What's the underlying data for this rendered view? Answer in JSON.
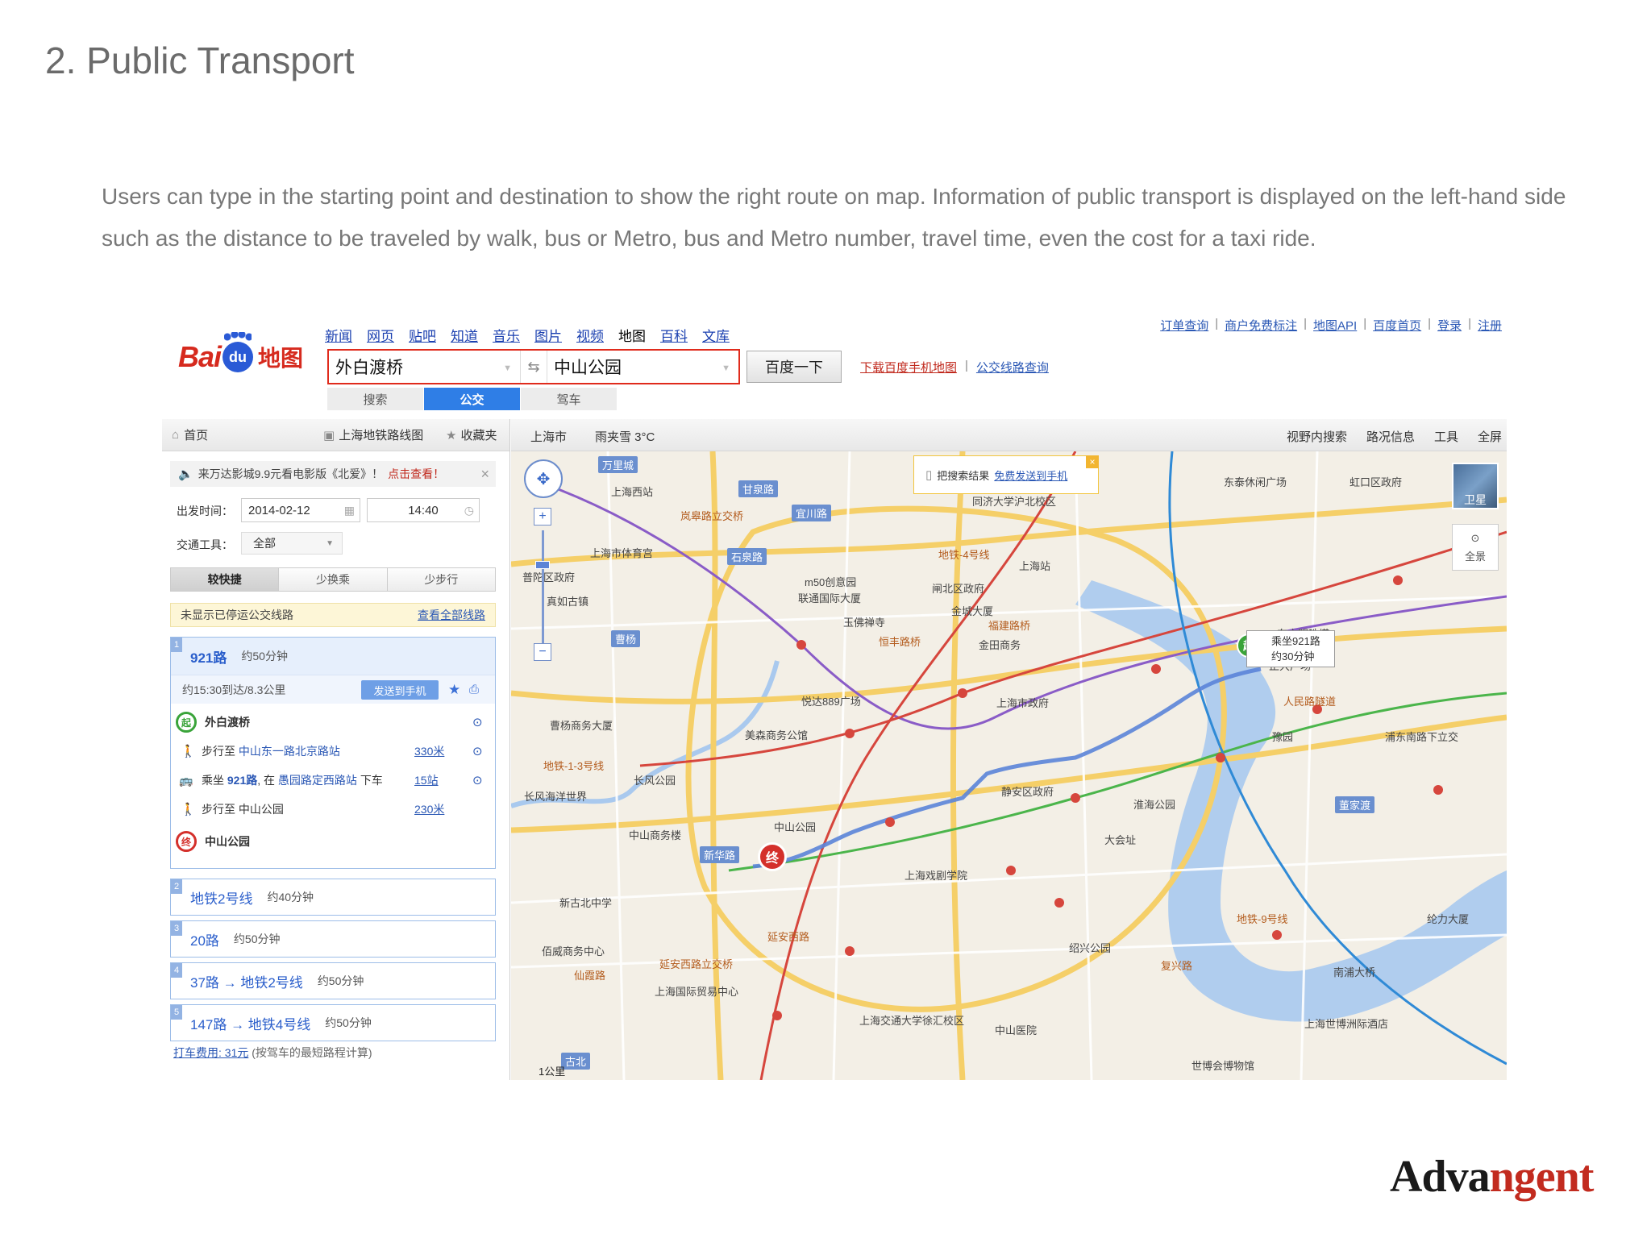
{
  "page": {
    "section_title": "2. Public Transport",
    "description": "Users can type in the starting point and destination to show the right route on map. Information of public transport is displayed on the left-hand side such as the distance to be traveled by walk, bus or Metro, bus and Metro number, travel time, even the cost for a taxi ride.",
    "brand_prefix": "Adva",
    "brand_suffix": "ngent",
    "brand_color": "#c22b1f"
  },
  "header": {
    "logo_bai": "Bai",
    "logo_du": "du",
    "logo_map": "地图",
    "nav": [
      "新闻",
      "网页",
      "贴吧",
      "知道",
      "音乐",
      "图片",
      "视频",
      "地图",
      "百科",
      "文库"
    ],
    "nav_current": "地图",
    "top_links": [
      "订单查询",
      "商户免费标注",
      "地图API",
      "百度首页",
      "登录",
      "注册"
    ],
    "from_value": "外白渡桥",
    "to_value": "中山公园",
    "search_button": "百度一下",
    "download_link": "下载百度手机地图",
    "bus_query_link": "公交线路查询",
    "mode_tabs": [
      "搜索",
      "公交",
      "驾车"
    ],
    "mode_active": "公交"
  },
  "left_panel": {
    "home": "首页",
    "subway_map": "上海地铁路线图",
    "favorites": "收藏夹",
    "notice_text": "来万达影城9.9元看电影版《北爱》！",
    "notice_link": "点击查看！",
    "depart_label": "出发时间：",
    "date_value": "2014-02-12",
    "time_value": "14:40",
    "transport_label": "交通工具：",
    "transport_value": "全部",
    "prefs": [
      "较快捷",
      "少换乘",
      "少步行"
    ],
    "pref_active": "较快捷",
    "hidden_notice": "未显示已停运公交线路",
    "show_all_link": "查看全部线路",
    "route1": {
      "index": "1",
      "name": "921路",
      "time": "约50分钟",
      "summary": "约15:30到达/8.3公里",
      "send_button": "发送到手机",
      "steps": [
        {
          "type": "start",
          "icon": "起",
          "text": "外白渡桥"
        },
        {
          "type": "walk",
          "prefix": "步行至",
          "place": "中山东一路北京路站",
          "dist": "330米"
        },
        {
          "type": "bus",
          "prefix": "乘坐",
          "line": "921路",
          "mid": ", 在",
          "stop": "愚园路定西路站",
          "suffix": "下车",
          "dist": "15站"
        },
        {
          "type": "walk",
          "prefix": "步行至",
          "place": "中山公园",
          "dist": "230米"
        },
        {
          "type": "end",
          "icon": "终",
          "text": "中山公园"
        }
      ]
    },
    "other_routes": [
      {
        "index": "2",
        "name": "地铁2号线",
        "time": "约40分钟"
      },
      {
        "index": "3",
        "name": "20路",
        "time": "约50分钟"
      },
      {
        "index": "4",
        "name": "37路 → 地铁2号线",
        "time": "约50分钟"
      },
      {
        "index": "5",
        "name": "147路 → 地铁4号线",
        "time": "约50分钟"
      }
    ],
    "taxi_link": "打车费用: 31元",
    "taxi_note": "(按驾车的最短路程计算)"
  },
  "map": {
    "city": "上海市",
    "weather": "雨夹雪 3°C",
    "tools": [
      "视野内搜索",
      "路况信息",
      "工具",
      "全屏"
    ],
    "callout_text": "把搜索结果",
    "callout_link": "免费发送到手机",
    "satellite": "卫星",
    "panorama": "全景",
    "scale": "1公里",
    "bus_bubble_line1": "乘坐921路",
    "bus_bubble_line2": "约30分钟",
    "start_icon": "起",
    "end_icon": "终",
    "labels": [
      {
        "t": "万里城",
        "s": "blue"
      },
      {
        "t": "甘泉路",
        "s": "blue"
      },
      {
        "t": "宜川路",
        "s": "blue"
      },
      {
        "t": "石泉路",
        "s": "blue"
      },
      {
        "t": "曹杨",
        "s": "blue"
      },
      {
        "t": "新华路",
        "s": "blue"
      },
      {
        "t": "董家渡",
        "s": "blue"
      },
      {
        "t": "古北",
        "s": "blue"
      },
      {
        "t": "上海西站",
        "s": ""
      },
      {
        "t": "岚皋路立交桥",
        "s": "road"
      },
      {
        "t": "东泰休闲广场",
        "s": ""
      },
      {
        "t": "虹口区政府",
        "s": ""
      },
      {
        "t": "上海市体育宫",
        "s": ""
      },
      {
        "t": "普陀区政府",
        "s": ""
      },
      {
        "t": "真如古镇",
        "s": ""
      },
      {
        "t": "m50创意园",
        "s": ""
      },
      {
        "t": "联通国际大厦",
        "s": ""
      },
      {
        "t": "玉佛禅寺",
        "s": ""
      },
      {
        "t": "闸北区政府",
        "s": ""
      },
      {
        "t": "金城大厦",
        "s": ""
      },
      {
        "t": "上海站",
        "s": ""
      },
      {
        "t": "恒丰路桥",
        "s": "road"
      },
      {
        "t": "福建路桥",
        "s": "road"
      },
      {
        "t": "金田商务",
        "s": ""
      },
      {
        "t": "东方明珠塔",
        "s": ""
      },
      {
        "t": "正大广场",
        "s": ""
      },
      {
        "t": "曹杨商务大厦",
        "s": ""
      },
      {
        "t": "悦达889广场",
        "s": ""
      },
      {
        "t": "上海市政府",
        "s": ""
      },
      {
        "t": "人民路隧道",
        "s": "road"
      },
      {
        "t": "浦东南路下立交",
        "s": ""
      },
      {
        "t": "豫园",
        "s": ""
      },
      {
        "t": "美森商务公馆",
        "s": ""
      },
      {
        "t": "长风公园",
        "s": ""
      },
      {
        "t": "长风海洋世界",
        "s": ""
      },
      {
        "t": "静安区政府",
        "s": ""
      },
      {
        "t": "淮海公园",
        "s": ""
      },
      {
        "t": "中山商务楼",
        "s": ""
      },
      {
        "t": "中山公园",
        "s": ""
      },
      {
        "t": "大会址",
        "s": ""
      },
      {
        "t": "上海戏剧学院",
        "s": ""
      },
      {
        "t": "新古北中学",
        "s": ""
      },
      {
        "t": "延安西路",
        "s": "road"
      },
      {
        "t": "绍兴公园",
        "s": ""
      },
      {
        "t": "南浦大桥",
        "s": ""
      },
      {
        "t": "佰威商务中心",
        "s": ""
      },
      {
        "t": "仙霞路",
        "s": "road"
      },
      {
        "t": "延安西路立交桥",
        "s": "road"
      },
      {
        "t": "上海国际贸易中心",
        "s": ""
      },
      {
        "t": "上海交通大学徐汇校区",
        "s": ""
      },
      {
        "t": "中山医院",
        "s": ""
      },
      {
        "t": "上海世博洲际酒店",
        "s": ""
      },
      {
        "t": "世博会博物馆",
        "s": ""
      },
      {
        "t": "同济大学沪北校区",
        "s": ""
      },
      {
        "t": "纶力大厦",
        "s": ""
      },
      {
        "t": "地铁-1-3号线",
        "s": "road"
      },
      {
        "t": "地铁-4号线",
        "s": "road"
      },
      {
        "t": "地铁-9号线",
        "s": "road"
      },
      {
        "t": "复兴路",
        "s": "road"
      }
    ]
  },
  "colors": {
    "baidu_red": "#d62a1e",
    "baidu_blue": "#2a5ad6",
    "link_blue": "#2b58b5",
    "route_blue": "#5b84d8"
  }
}
